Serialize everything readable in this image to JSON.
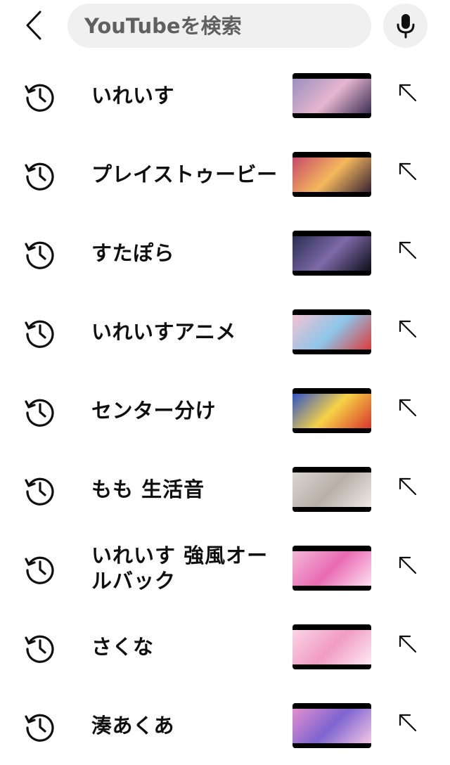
{
  "search": {
    "placeholder": "YouTubeを検索",
    "value": ""
  },
  "icons": {
    "back": "chevron-left-icon",
    "mic": "microphone-icon",
    "history": "history-clock-icon",
    "fill": "arrow-up-left-icon"
  },
  "suggestions": [
    {
      "text": "いれいす",
      "thumb_colors": [
        "#9a8fc0",
        "#e7b6d0",
        "#3c2f56"
      ]
    },
    {
      "text": "プレイストゥービー",
      "thumb_colors": [
        "#c74a6a",
        "#f4b85c",
        "#3a2233"
      ]
    },
    {
      "text": "すたぽら",
      "thumb_colors": [
        "#2a2d52",
        "#7d6aa8",
        "#0d0d1a"
      ]
    },
    {
      "text": "いれいすアニメ",
      "thumb_colors": [
        "#f3c2d2",
        "#8cc6ea",
        "#e03a3a"
      ]
    },
    {
      "text": "センター分け",
      "thumb_colors": [
        "#2e54c7",
        "#f7d246",
        "#d8362b"
      ]
    },
    {
      "text": "もも 生活音",
      "thumb_colors": [
        "#d9d5d0",
        "#b8b0a8",
        "#eeeae6"
      ]
    },
    {
      "text": "いれいす 強風オールバック",
      "thumb_colors": [
        "#f4b7d8",
        "#e86ab3",
        "#fde0ef"
      ]
    },
    {
      "text": "さくな",
      "thumb_colors": [
        "#fbd5e6",
        "#f19bc3",
        "#fdebf3"
      ]
    },
    {
      "text": "湊あくあ",
      "thumb_colors": [
        "#e38fd0",
        "#7d64d0",
        "#f5c6e5"
      ]
    }
  ]
}
